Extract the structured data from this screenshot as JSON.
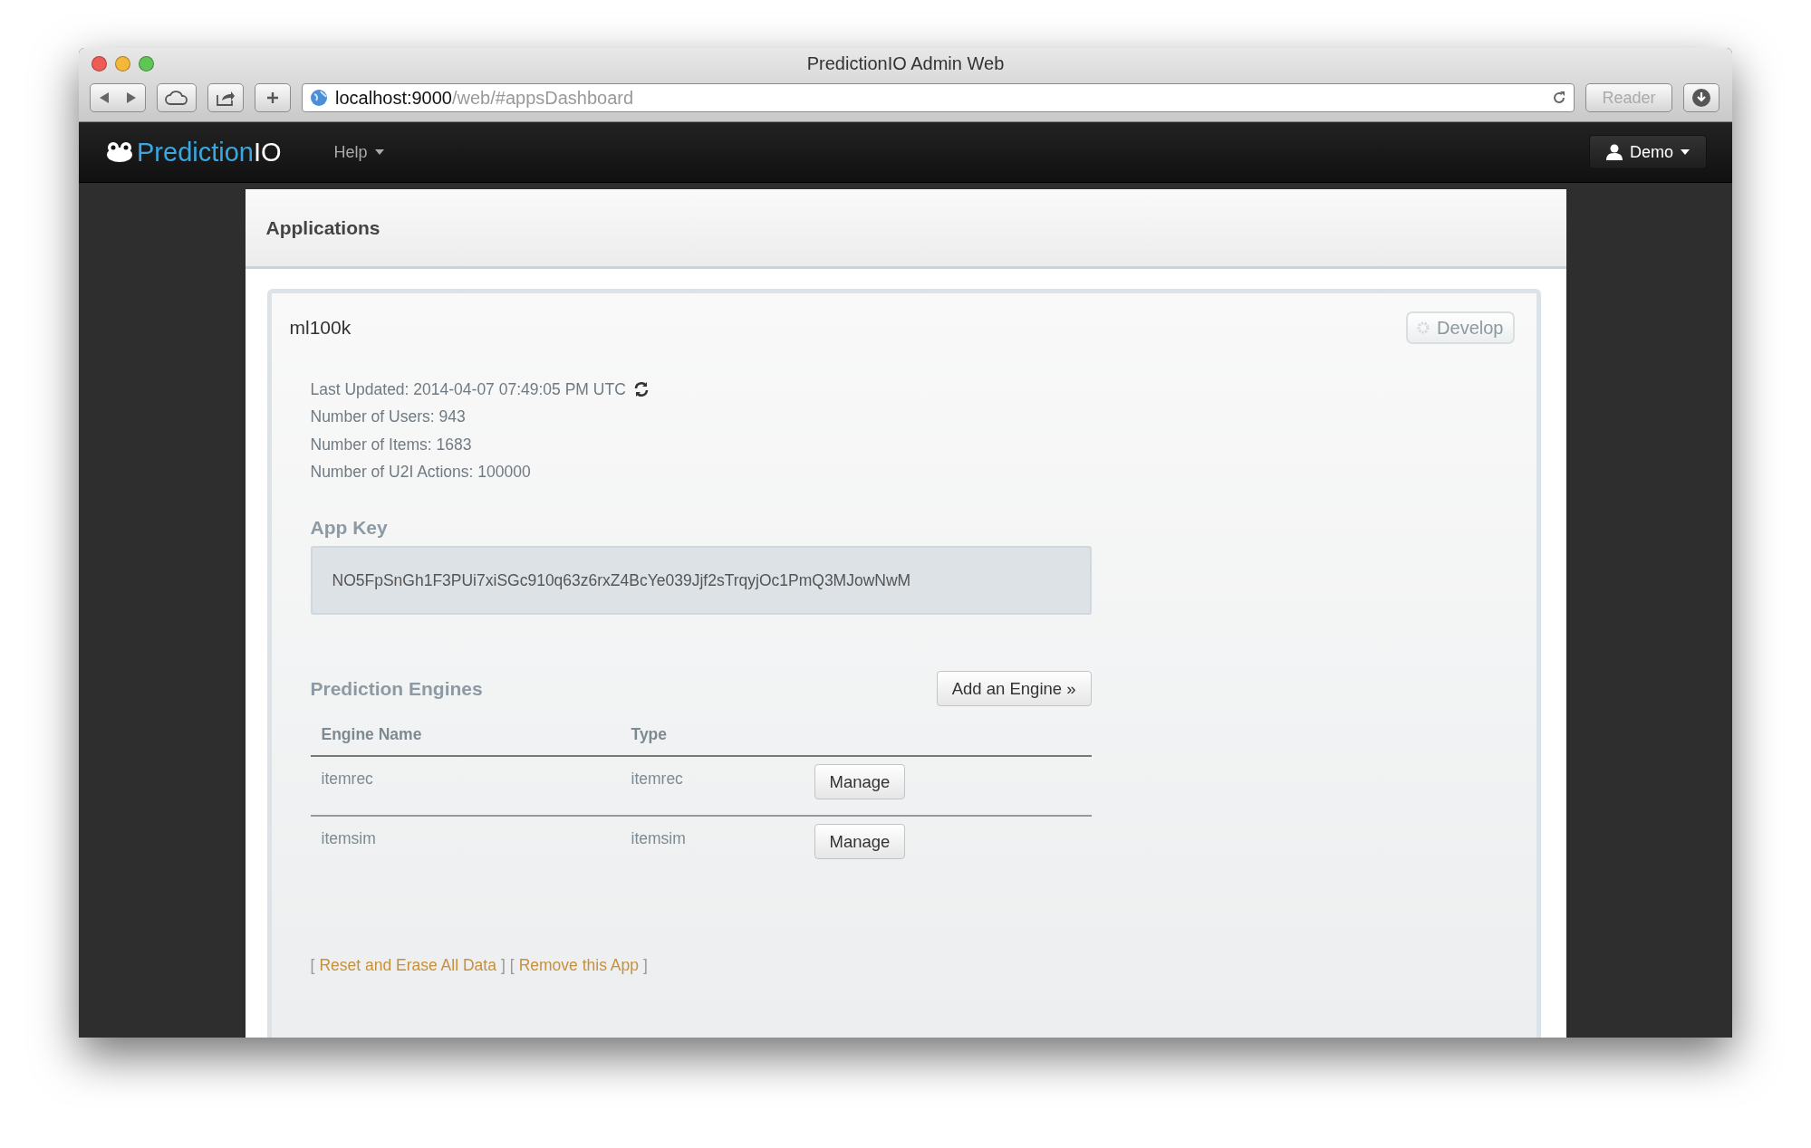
{
  "window": {
    "title": "PredictionIO Admin Web"
  },
  "browser": {
    "url_host": "localhost:9000",
    "url_path": "/web/#appsDashboard",
    "reader": "Reader"
  },
  "navbar": {
    "brand_prefix": "Prediction",
    "brand_suffix": "IO",
    "menu": "Help",
    "user": "Demo"
  },
  "panel": {
    "title": "Applications"
  },
  "app": {
    "name": "ml100k",
    "develop_button": "Develop",
    "stats": [
      {
        "text": "Last Updated: 2014-04-07 07:49:05 PM UTC",
        "refresh": true
      },
      {
        "text": "Number of Users: 943",
        "refresh": false
      },
      {
        "text": "Number of Items: 1683",
        "refresh": false
      },
      {
        "text": "Number of U2I Actions: 100000",
        "refresh": false
      }
    ],
    "app_key_label": "App Key",
    "app_key": "NO5FpSnGh1F3PUi7xiSGc910q63z6rxZ4BcYe039Jjf2sTrqyjOc1PmQ3MJowNwM",
    "engines_title": "Prediction Engines",
    "add_engine_button": "Add an Engine »",
    "table": {
      "columns": [
        "Engine Name",
        "Type"
      ],
      "rows": [
        {
          "name": "itemrec",
          "type": "itemrec",
          "action": "Manage"
        },
        {
          "name": "itemsim",
          "type": "itemsim",
          "action": "Manage"
        }
      ]
    },
    "footer": [
      {
        "kind": "bracket",
        "text": "["
      },
      {
        "kind": "link",
        "text": "Reset and Erase All Data"
      },
      {
        "kind": "bracket",
        "text": "]"
      },
      {
        "kind": "bracket",
        "text": "["
      },
      {
        "kind": "link",
        "text": "Remove this App"
      },
      {
        "kind": "bracket",
        "text": "]"
      }
    ]
  }
}
